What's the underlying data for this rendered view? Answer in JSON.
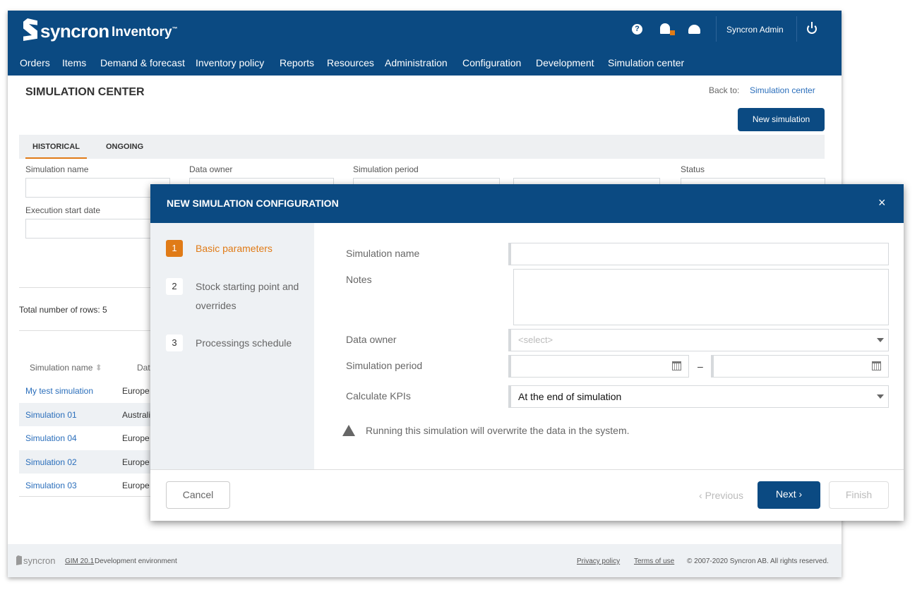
{
  "header": {
    "brand": "syncron",
    "product": "Inventory",
    "tm": "™",
    "user": "Syncron Admin",
    "nav": [
      "Orders",
      "Items",
      "Demand & forecast",
      "Inventory policy",
      "Reports",
      "Resources",
      "Administration",
      "Configuration",
      "Development",
      "Simulation center"
    ]
  },
  "page": {
    "title": "SIMULATION CENTER",
    "back_to_label": "Back to:",
    "back_to_link": "Simulation center",
    "new_simulation": "New simulation",
    "tabs": [
      "HISTORICAL",
      "ONGOING"
    ],
    "filters": {
      "simulation_name": "Simulation name",
      "data_owner": "Data owner",
      "simulation_period": "Simulation period",
      "status": "Status",
      "execution_start_date": "Execution start date"
    },
    "total_rows": "Total number of rows: 5",
    "table": {
      "headers": [
        "Simulation name",
        "Data owner"
      ],
      "rows": [
        [
          "My test simulation",
          "Europe"
        ],
        [
          "Simulation 01",
          "Australia"
        ],
        [
          "Simulation 04",
          "Europe"
        ],
        [
          "Simulation 02",
          "Europe"
        ],
        [
          "Simulation 03",
          "Europe"
        ]
      ]
    }
  },
  "footer": {
    "brand": "syncron",
    "version_link": "GIM 20.1",
    "env": "Development environment",
    "privacy": "Privacy policy",
    "terms": "Terms of use",
    "copyright": "© 2007-2020 Syncron AB. All rights reserved."
  },
  "modal": {
    "title": "NEW SIMULATION CONFIGURATION",
    "steps": [
      {
        "num": "1",
        "label": "Basic parameters"
      },
      {
        "num": "2",
        "label": "Stock starting point and overrides"
      },
      {
        "num": "3",
        "label": "Processings schedule"
      }
    ],
    "fields": {
      "simulation_name": "Simulation name",
      "notes": "Notes",
      "data_owner": "Data owner",
      "data_owner_placeholder": "<select>",
      "simulation_period": "Simulation period",
      "period_sep": "–",
      "calculate_kpis": "Calculate KPIs",
      "calculate_kpis_value": "At the end of simulation"
    },
    "warning": "Running this simulation will overwrite the data in the system.",
    "cancel": "Cancel",
    "previous": "Previous",
    "next": "Next",
    "finish": "Finish"
  },
  "colors": {
    "primary": "#0b4a82",
    "accent": "#e07b17",
    "link": "#2a6ebb"
  }
}
